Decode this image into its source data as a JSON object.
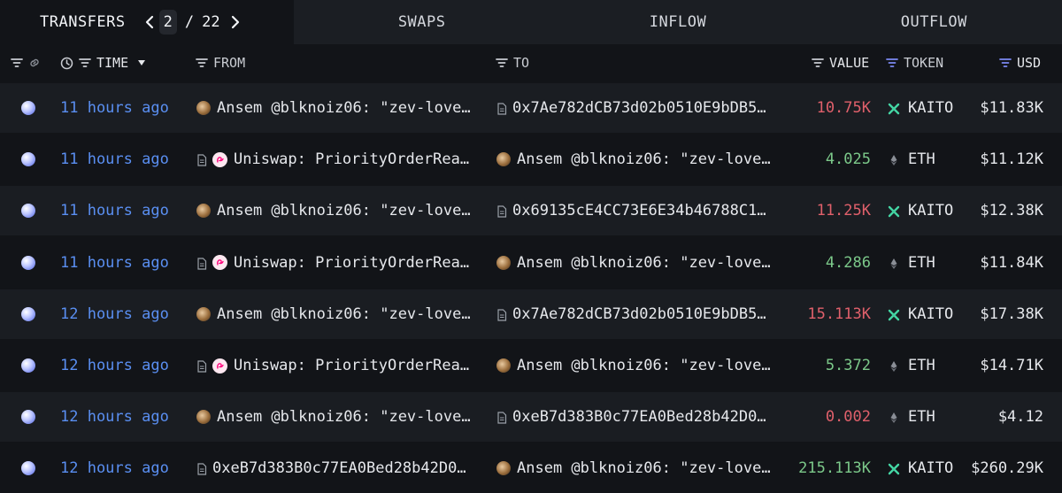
{
  "tabs": {
    "transfers": "TRANSFERS",
    "swaps": "SWAPS",
    "inflow": "INFLOW",
    "outflow": "OUTFLOW"
  },
  "pager": {
    "current": "2",
    "separator": "/",
    "total": "22"
  },
  "columns": {
    "time": "TIME",
    "from": "FROM",
    "to": "TO",
    "value": "VALUE",
    "token": "TOKEN",
    "usd": "USD"
  },
  "colors": {
    "time_link": "#5a8ff2",
    "value_out": "#e0606b",
    "value_in": "#7cc98a",
    "filter_active": "#7b88f2"
  },
  "rows": [
    {
      "time": "11 hours ago",
      "from": "Ansem @blknoiz06: \"zev-love…",
      "from_icon": "avatar-icon",
      "to": "0x7Ae782dCB73d02b0510E9bDB5…",
      "to_icon": "contract-doc-icon",
      "value": "10.75K",
      "direction": "out",
      "token": "KAITO",
      "token_icon": "kaito-icon",
      "usd": "$11.83K"
    },
    {
      "time": "11 hours ago",
      "from": "Uniswap: PriorityOrderRea…",
      "from_icon": "uniswap-icon",
      "to": "Ansem @blknoiz06: \"zev-love…",
      "to_icon": "avatar-icon",
      "value": "4.025",
      "direction": "in",
      "token": "ETH",
      "token_icon": "eth-icon",
      "usd": "$11.12K"
    },
    {
      "time": "11 hours ago",
      "from": "Ansem @blknoiz06: \"zev-love…",
      "from_icon": "avatar-icon",
      "to": "0x69135cE4CC73E6E34b46788C1…",
      "to_icon": "contract-doc-icon",
      "value": "11.25K",
      "direction": "out",
      "token": "KAITO",
      "token_icon": "kaito-icon",
      "usd": "$12.38K"
    },
    {
      "time": "11 hours ago",
      "from": "Uniswap: PriorityOrderRea…",
      "from_icon": "uniswap-icon",
      "to": "Ansem @blknoiz06: \"zev-love…",
      "to_icon": "avatar-icon",
      "value": "4.286",
      "direction": "in",
      "token": "ETH",
      "token_icon": "eth-icon",
      "usd": "$11.84K"
    },
    {
      "time": "12 hours ago",
      "from": "Ansem @blknoiz06: \"zev-love…",
      "from_icon": "avatar-icon",
      "to": "0x7Ae782dCB73d02b0510E9bDB5…",
      "to_icon": "contract-doc-icon",
      "value": "15.113K",
      "direction": "out",
      "token": "KAITO",
      "token_icon": "kaito-icon",
      "usd": "$17.38K"
    },
    {
      "time": "12 hours ago",
      "from": "Uniswap: PriorityOrderRea…",
      "from_icon": "uniswap-icon",
      "to": "Ansem @blknoiz06: \"zev-love…",
      "to_icon": "avatar-icon",
      "value": "5.372",
      "direction": "in",
      "token": "ETH",
      "token_icon": "eth-icon",
      "usd": "$14.71K"
    },
    {
      "time": "12 hours ago",
      "from": "Ansem @blknoiz06: \"zev-love…",
      "from_icon": "avatar-icon",
      "to": "0xeB7d383B0c77EA0Bed28b42D0…",
      "to_icon": "contract-doc-icon",
      "value": "0.002",
      "direction": "out",
      "token": "ETH",
      "token_icon": "eth-icon",
      "usd": "$4.12"
    },
    {
      "time": "12 hours ago",
      "from": "0xeB7d383B0c77EA0Bed28b42D0…",
      "from_icon": "contract-doc-icon",
      "to": "Ansem @blknoiz06: \"zev-love…",
      "to_icon": "avatar-icon",
      "value": "215.113K",
      "direction": "in",
      "token": "KAITO",
      "token_icon": "kaito-icon",
      "usd": "$260.29K"
    }
  ]
}
